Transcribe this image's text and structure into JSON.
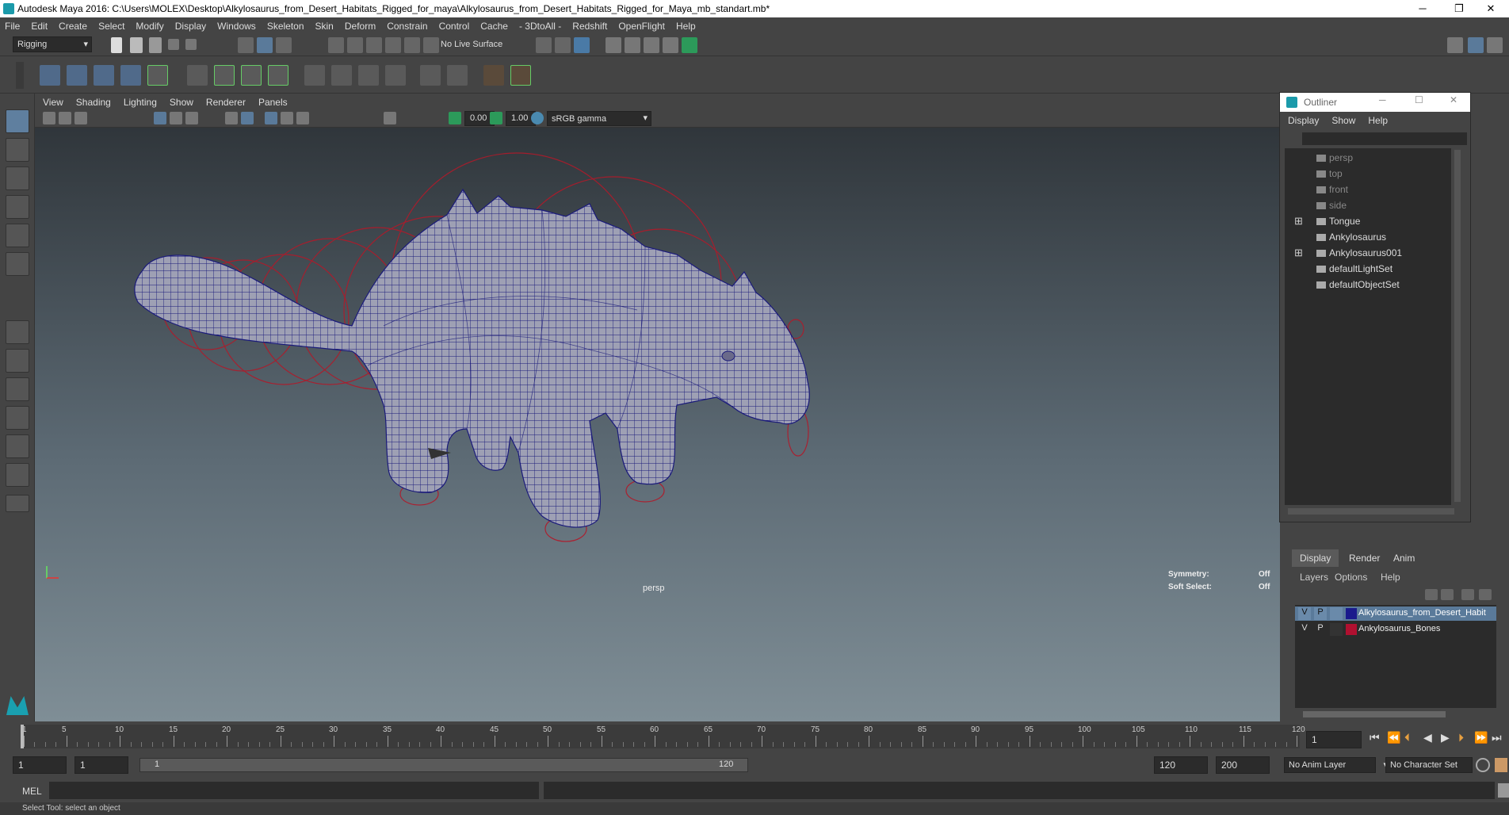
{
  "window": {
    "title": "Autodesk Maya 2016: C:\\Users\\MOLEX\\Desktop\\Alkylosaurus_from_Desert_Habitats_Rigged_for_maya\\Alkylosaurus_from_Desert_Habitats_Rigged_for_Maya_mb_standart.mb*",
    "min": "─",
    "restore": "❐",
    "close": "✕"
  },
  "menubar": [
    "File",
    "Edit",
    "Create",
    "Select",
    "Modify",
    "Display",
    "Windows",
    "Skeleton",
    "Skin",
    "Deform",
    "Constrain",
    "Control",
    "Cache",
    "- 3DtoAll -",
    "Redshift",
    "OpenFlight",
    "Help"
  ],
  "statusline": {
    "mode": "Rigging",
    "live_surface": "No Live Surface"
  },
  "viewport": {
    "menu": [
      "View",
      "Shading",
      "Lighting",
      "Show",
      "Renderer",
      "Panels"
    ],
    "exposure": "0.00",
    "gamma": "1.00",
    "colorspace": "sRGB gamma",
    "camera_label": "persp",
    "symmetry_label": "Symmetry:",
    "symmetry_value": "Off",
    "soft_select_label": "Soft Select:",
    "soft_select_value": "Off"
  },
  "outliner": {
    "title": "Outliner",
    "menu": [
      "Display",
      "Show",
      "Help"
    ],
    "items": [
      {
        "label": "persp",
        "dim": true
      },
      {
        "label": "top",
        "dim": true
      },
      {
        "label": "front",
        "dim": true
      },
      {
        "label": "side",
        "dim": true
      },
      {
        "label": "Tongue",
        "dim": false,
        "expand": true
      },
      {
        "label": "Ankylosaurus",
        "dim": false,
        "expand": false
      },
      {
        "label": "Ankylosaurus001",
        "dim": false,
        "expand": true
      },
      {
        "label": "defaultLightSet",
        "dim": false,
        "expand": false
      },
      {
        "label": "defaultObjectSet",
        "dim": false,
        "expand": false
      }
    ]
  },
  "layers": {
    "tabs": [
      "Display",
      "Render",
      "Anim"
    ],
    "menu": [
      "Layers",
      "Options",
      "Help"
    ],
    "rows": [
      {
        "v": "V",
        "p": "P",
        "color": "#1a1a8c",
        "name": "Alkylosaurus_from_Desert_Habit",
        "selected": true
      },
      {
        "v": "V",
        "p": "P",
        "color": "#b01030",
        "name": "Ankylosaurus_Bones",
        "selected": false
      }
    ]
  },
  "timeline": {
    "ticks": [
      "1",
      "5",
      "10",
      "15",
      "20",
      "25",
      "30",
      "35",
      "40",
      "45",
      "50",
      "55",
      "60",
      "65",
      "70",
      "75",
      "80",
      "85",
      "90",
      "95",
      "100",
      "105",
      "110",
      "115",
      "120"
    ],
    "current_frame": "1"
  },
  "range": {
    "start": "1",
    "anim_start": "1",
    "slider_start": "1",
    "slider_end": "120",
    "anim_end": "120",
    "end": "200",
    "anim_layer": "No Anim Layer",
    "character_set": "No Character Set"
  },
  "cmdline": {
    "label": "MEL"
  },
  "helpline": "Select Tool: select an object"
}
